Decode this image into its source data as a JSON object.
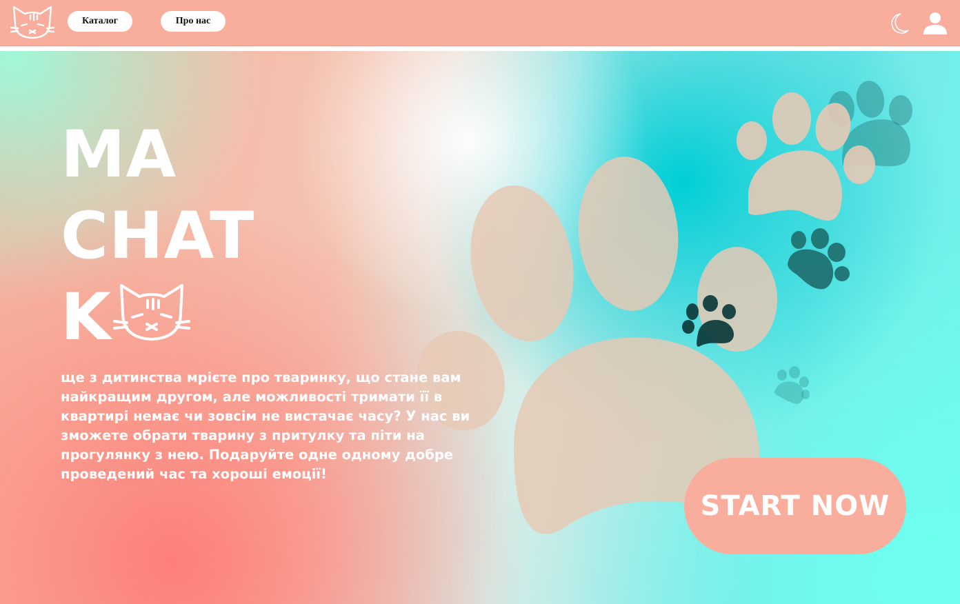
{
  "header": {
    "logo_icon": "cat-face-icon",
    "nav": [
      {
        "label": "Каталог"
      },
      {
        "label": "Про нас"
      }
    ],
    "theme_icon": "moon-icon",
    "profile_icon": "user-icon"
  },
  "hero": {
    "title_lines": [
      "MA",
      "CHAT",
      "K"
    ],
    "title_icon": "cat-face-icon",
    "description": "ще з дитинства мрієте про тваринку, що стане вам найкращим другом, але можливості тримати її в квартирі немає чи зовсім не вистачає часу? У нас ви зможете обрати тварину з притулку та піти на прогулянку з нею. Подаруйте одне одному добре проведений час та хороші емоції!",
    "cta_label": "START NOW",
    "decor_icon": "paw-print-icon"
  },
  "colors": {
    "header_bg": "#f9ae9d",
    "button_bg": "#f9ae9d",
    "paw_beige": "#e6c9b5",
    "paw_teal": "#1d6d6c"
  }
}
